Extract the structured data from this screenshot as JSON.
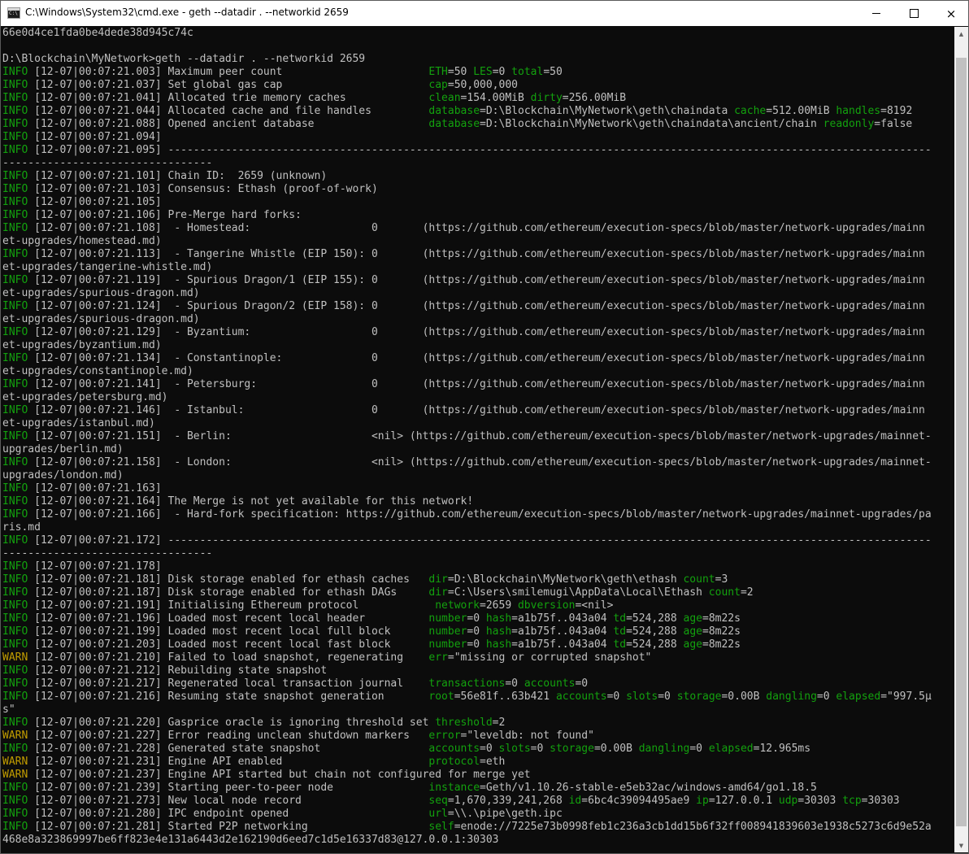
{
  "window": {
    "title": "C:\\Windows\\System32\\cmd.exe - geth  --datadir . --networkid 2659",
    "icon": "cmd-icon",
    "buttons": {
      "minimize": "minimize-icon",
      "maximize": "maximize-icon",
      "close": "×"
    }
  },
  "colors": {
    "info": "#13a10e",
    "warn": "#c19c00",
    "text": "#c0c0c0",
    "background": "#0c0c0c"
  },
  "console": {
    "lines": [
      [
        {
          "t": "66e0d4ce1fda0be4dede38d945c74c"
        }
      ],
      [
        {
          "t": ""
        }
      ],
      [
        {
          "t": "D:\\Blockchain\\MyNetwork>geth --datadir . --networkid 2659"
        }
      ],
      [
        {
          "t": "INFO",
          "c": "info"
        },
        {
          "t": " [12-07|00:07:21.003] Maximum peer count                       "
        },
        {
          "t": "ETH",
          "c": "k"
        },
        {
          "t": "=50 "
        },
        {
          "t": "LES",
          "c": "k"
        },
        {
          "t": "=0 "
        },
        {
          "t": "total",
          "c": "k"
        },
        {
          "t": "=50"
        }
      ],
      [
        {
          "t": "INFO",
          "c": "info"
        },
        {
          "t": " [12-07|00:07:21.037] Set global gas cap                       "
        },
        {
          "t": "cap",
          "c": "k"
        },
        {
          "t": "=50,000,000"
        }
      ],
      [
        {
          "t": "INFO",
          "c": "info"
        },
        {
          "t": " [12-07|00:07:21.041] Allocated trie memory caches             "
        },
        {
          "t": "clean",
          "c": "k"
        },
        {
          "t": "=154.00MiB "
        },
        {
          "t": "dirty",
          "c": "k"
        },
        {
          "t": "=256.00MiB"
        }
      ],
      [
        {
          "t": "INFO",
          "c": "info"
        },
        {
          "t": " [12-07|00:07:21.044] Allocated cache and file handles         "
        },
        {
          "t": "database",
          "c": "k"
        },
        {
          "t": "=D:\\Blockchain\\MyNetwork\\geth\\chaindata "
        },
        {
          "t": "cache",
          "c": "k"
        },
        {
          "t": "=512.00MiB "
        },
        {
          "t": "handles",
          "c": "k"
        },
        {
          "t": "=8192"
        }
      ],
      [
        {
          "t": "INFO",
          "c": "info"
        },
        {
          "t": " [12-07|00:07:21.088] Opened ancient database                  "
        },
        {
          "t": "database",
          "c": "k"
        },
        {
          "t": "=D:\\Blockchain\\MyNetwork\\geth\\chaindata\\ancient/chain "
        },
        {
          "t": "readonly",
          "c": "k"
        },
        {
          "t": "=false"
        }
      ],
      [
        {
          "t": "INFO",
          "c": "info"
        },
        {
          "t": " [12-07|00:07:21.094]"
        }
      ],
      [
        {
          "t": "INFO",
          "c": "info"
        },
        {
          "t": " [12-07|00:07:21.095] ------------------------------------------------------------------------------------------------------------------------"
        }
      ],
      [
        {
          "t": "---------------------------------"
        }
      ],
      [
        {
          "t": "INFO",
          "c": "info"
        },
        {
          "t": " [12-07|00:07:21.101] Chain ID:  2659 (unknown)"
        }
      ],
      [
        {
          "t": "INFO",
          "c": "info"
        },
        {
          "t": " [12-07|00:07:21.103] Consensus: Ethash (proof-of-work)"
        }
      ],
      [
        {
          "t": "INFO",
          "c": "info"
        },
        {
          "t": " [12-07|00:07:21.105]"
        }
      ],
      [
        {
          "t": "INFO",
          "c": "info"
        },
        {
          "t": " [12-07|00:07:21.106] Pre-Merge hard forks:"
        }
      ],
      [
        {
          "t": "INFO",
          "c": "info"
        },
        {
          "t": " [12-07|00:07:21.108]  - Homestead:                   0       (https://github.com/ethereum/execution-specs/blob/master/network-upgrades/mainn"
        }
      ],
      [
        {
          "t": "et-upgrades/homestead.md)"
        }
      ],
      [
        {
          "t": "INFO",
          "c": "info"
        },
        {
          "t": " [12-07|00:07:21.113]  - Tangerine Whistle (EIP 150): 0       (https://github.com/ethereum/execution-specs/blob/master/network-upgrades/mainn"
        }
      ],
      [
        {
          "t": "et-upgrades/tangerine-whistle.md)"
        }
      ],
      [
        {
          "t": "INFO",
          "c": "info"
        },
        {
          "t": " [12-07|00:07:21.119]  - Spurious Dragon/1 (EIP 155): 0       (https://github.com/ethereum/execution-specs/blob/master/network-upgrades/mainn"
        }
      ],
      [
        {
          "t": "et-upgrades/spurious-dragon.md)"
        }
      ],
      [
        {
          "t": "INFO",
          "c": "info"
        },
        {
          "t": " [12-07|00:07:21.124]  - Spurious Dragon/2 (EIP 158): 0       (https://github.com/ethereum/execution-specs/blob/master/network-upgrades/mainn"
        }
      ],
      [
        {
          "t": "et-upgrades/spurious-dragon.md)"
        }
      ],
      [
        {
          "t": "INFO",
          "c": "info"
        },
        {
          "t": " [12-07|00:07:21.129]  - Byzantium:                   0       (https://github.com/ethereum/execution-specs/blob/master/network-upgrades/mainn"
        }
      ],
      [
        {
          "t": "et-upgrades/byzantium.md)"
        }
      ],
      [
        {
          "t": "INFO",
          "c": "info"
        },
        {
          "t": " [12-07|00:07:21.134]  - Constantinople:              0       (https://github.com/ethereum/execution-specs/blob/master/network-upgrades/mainn"
        }
      ],
      [
        {
          "t": "et-upgrades/constantinople.md)"
        }
      ],
      [
        {
          "t": "INFO",
          "c": "info"
        },
        {
          "t": " [12-07|00:07:21.141]  - Petersburg:                  0       (https://github.com/ethereum/execution-specs/blob/master/network-upgrades/mainn"
        }
      ],
      [
        {
          "t": "et-upgrades/petersburg.md)"
        }
      ],
      [
        {
          "t": "INFO",
          "c": "info"
        },
        {
          "t": " [12-07|00:07:21.146]  - Istanbul:                    0       (https://github.com/ethereum/execution-specs/blob/master/network-upgrades/mainn"
        }
      ],
      [
        {
          "t": "et-upgrades/istanbul.md)"
        }
      ],
      [
        {
          "t": "INFO",
          "c": "info"
        },
        {
          "t": " [12-07|00:07:21.151]  - Berlin:                      <nil> (https://github.com/ethereum/execution-specs/blob/master/network-upgrades/mainnet-"
        }
      ],
      [
        {
          "t": "upgrades/berlin.md)"
        }
      ],
      [
        {
          "t": "INFO",
          "c": "info"
        },
        {
          "t": " [12-07|00:07:21.158]  - London:                      <nil> (https://github.com/ethereum/execution-specs/blob/master/network-upgrades/mainnet-"
        }
      ],
      [
        {
          "t": "upgrades/london.md)"
        }
      ],
      [
        {
          "t": "INFO",
          "c": "info"
        },
        {
          "t": " [12-07|00:07:21.163]"
        }
      ],
      [
        {
          "t": "INFO",
          "c": "info"
        },
        {
          "t": " [12-07|00:07:21.164] The Merge is not yet available for this network!"
        }
      ],
      [
        {
          "t": "INFO",
          "c": "info"
        },
        {
          "t": " [12-07|00:07:21.166]  - Hard-fork specification: https://github.com/ethereum/execution-specs/blob/master/network-upgrades/mainnet-upgrades/pa"
        }
      ],
      [
        {
          "t": "ris.md"
        }
      ],
      [
        {
          "t": "INFO",
          "c": "info"
        },
        {
          "t": " [12-07|00:07:21.172] ------------------------------------------------------------------------------------------------------------------------"
        }
      ],
      [
        {
          "t": "---------------------------------"
        }
      ],
      [
        {
          "t": "INFO",
          "c": "info"
        },
        {
          "t": " [12-07|00:07:21.178]"
        }
      ],
      [
        {
          "t": "INFO",
          "c": "info"
        },
        {
          "t": " [12-07|00:07:21.181] Disk storage enabled for ethash caches   "
        },
        {
          "t": "dir",
          "c": "k"
        },
        {
          "t": "=D:\\Blockchain\\MyNetwork\\geth\\ethash "
        },
        {
          "t": "count",
          "c": "k"
        },
        {
          "t": "=3"
        }
      ],
      [
        {
          "t": "INFO",
          "c": "info"
        },
        {
          "t": " [12-07|00:07:21.187] Disk storage enabled for ethash DAGs     "
        },
        {
          "t": "dir",
          "c": "k"
        },
        {
          "t": "=C:\\Users\\smilemugi\\AppData\\Local\\Ethash "
        },
        {
          "t": "count",
          "c": "k"
        },
        {
          "t": "=2"
        }
      ],
      [
        {
          "t": "INFO",
          "c": "info"
        },
        {
          "t": " [12-07|00:07:21.191] Initialising Ethereum protocol            "
        },
        {
          "t": "network",
          "c": "k"
        },
        {
          "t": "=2659 "
        },
        {
          "t": "dbversion",
          "c": "k"
        },
        {
          "t": "=<nil>"
        }
      ],
      [
        {
          "t": "INFO",
          "c": "info"
        },
        {
          "t": " [12-07|00:07:21.196] Loaded most recent local header          "
        },
        {
          "t": "number",
          "c": "k"
        },
        {
          "t": "=0 "
        },
        {
          "t": "hash",
          "c": "k"
        },
        {
          "t": "=a1b75f..043a04 "
        },
        {
          "t": "td",
          "c": "k"
        },
        {
          "t": "=524,288 "
        },
        {
          "t": "age",
          "c": "k"
        },
        {
          "t": "=8m22s"
        }
      ],
      [
        {
          "t": "INFO",
          "c": "info"
        },
        {
          "t": " [12-07|00:07:21.199] Loaded most recent local full block      "
        },
        {
          "t": "number",
          "c": "k"
        },
        {
          "t": "=0 "
        },
        {
          "t": "hash",
          "c": "k"
        },
        {
          "t": "=a1b75f..043a04 "
        },
        {
          "t": "td",
          "c": "k"
        },
        {
          "t": "=524,288 "
        },
        {
          "t": "age",
          "c": "k"
        },
        {
          "t": "=8m22s"
        }
      ],
      [
        {
          "t": "INFO",
          "c": "info"
        },
        {
          "t": " [12-07|00:07:21.203] Loaded most recent local fast block      "
        },
        {
          "t": "number",
          "c": "k"
        },
        {
          "t": "=0 "
        },
        {
          "t": "hash",
          "c": "k"
        },
        {
          "t": "=a1b75f..043a04 "
        },
        {
          "t": "td",
          "c": "k"
        },
        {
          "t": "=524,288 "
        },
        {
          "t": "age",
          "c": "k"
        },
        {
          "t": "=8m22s"
        }
      ],
      [
        {
          "t": "WARN",
          "c": "warn"
        },
        {
          "t": " [12-07|00:07:21.210] Failed to load snapshot, regenerating    "
        },
        {
          "t": "err",
          "c": "k"
        },
        {
          "t": "=\"missing or corrupted snapshot\""
        }
      ],
      [
        {
          "t": "INFO",
          "c": "info"
        },
        {
          "t": " [12-07|00:07:21.212] Rebuilding state snapshot"
        }
      ],
      [
        {
          "t": "INFO",
          "c": "info"
        },
        {
          "t": " [12-07|00:07:21.217] Regenerated local transaction journal    "
        },
        {
          "t": "transactions",
          "c": "k"
        },
        {
          "t": "=0 "
        },
        {
          "t": "accounts",
          "c": "k"
        },
        {
          "t": "=0"
        }
      ],
      [
        {
          "t": "INFO",
          "c": "info"
        },
        {
          "t": " [12-07|00:07:21.216] Resuming state snapshot generation       "
        },
        {
          "t": "root",
          "c": "k"
        },
        {
          "t": "=56e81f..63b421 "
        },
        {
          "t": "accounts",
          "c": "k"
        },
        {
          "t": "=0 "
        },
        {
          "t": "slots",
          "c": "k"
        },
        {
          "t": "=0 "
        },
        {
          "t": "storage",
          "c": "k"
        },
        {
          "t": "=0.00B "
        },
        {
          "t": "dangling",
          "c": "k"
        },
        {
          "t": "=0 "
        },
        {
          "t": "elapsed",
          "c": "k"
        },
        {
          "t": "=\"997.5μ"
        }
      ],
      [
        {
          "t": "s\""
        }
      ],
      [
        {
          "t": "INFO",
          "c": "info"
        },
        {
          "t": " [12-07|00:07:21.220] Gasprice oracle is ignoring threshold set "
        },
        {
          "t": "threshold",
          "c": "k"
        },
        {
          "t": "=2"
        }
      ],
      [
        {
          "t": "WARN",
          "c": "warn"
        },
        {
          "t": " [12-07|00:07:21.227] Error reading unclean shutdown markers   "
        },
        {
          "t": "error",
          "c": "k"
        },
        {
          "t": "=\"leveldb: not found\""
        }
      ],
      [
        {
          "t": "INFO",
          "c": "info"
        },
        {
          "t": " [12-07|00:07:21.228] Generated state snapshot                 "
        },
        {
          "t": "accounts",
          "c": "k"
        },
        {
          "t": "=0 "
        },
        {
          "t": "slots",
          "c": "k"
        },
        {
          "t": "=0 "
        },
        {
          "t": "storage",
          "c": "k"
        },
        {
          "t": "=0.00B "
        },
        {
          "t": "dangling",
          "c": "k"
        },
        {
          "t": "=0 "
        },
        {
          "t": "elapsed",
          "c": "k"
        },
        {
          "t": "=12.965ms"
        }
      ],
      [
        {
          "t": "WARN",
          "c": "warn"
        },
        {
          "t": " [12-07|00:07:21.231] Engine API enabled                       "
        },
        {
          "t": "protocol",
          "c": "k"
        },
        {
          "t": "=eth"
        }
      ],
      [
        {
          "t": "WARN",
          "c": "warn"
        },
        {
          "t": " [12-07|00:07:21.237] Engine API started but chain not configured for merge yet"
        }
      ],
      [
        {
          "t": "INFO",
          "c": "info"
        },
        {
          "t": " [12-07|00:07:21.239] Starting peer-to-peer node               "
        },
        {
          "t": "instance",
          "c": "k"
        },
        {
          "t": "=Geth/v1.10.26-stable-e5eb32ac/windows-amd64/go1.18.5"
        }
      ],
      [
        {
          "t": "INFO",
          "c": "info"
        },
        {
          "t": " [12-07|00:07:21.273] New local node record                    "
        },
        {
          "t": "seq",
          "c": "k"
        },
        {
          "t": "=1,670,339,241,268 "
        },
        {
          "t": "id",
          "c": "k"
        },
        {
          "t": "=6bc4c39094495ae9 "
        },
        {
          "t": "ip",
          "c": "k"
        },
        {
          "t": "=127.0.0.1 "
        },
        {
          "t": "udp",
          "c": "k"
        },
        {
          "t": "=30303 "
        },
        {
          "t": "tcp",
          "c": "k"
        },
        {
          "t": "=30303"
        }
      ],
      [
        {
          "t": "INFO",
          "c": "info"
        },
        {
          "t": " [12-07|00:07:21.280] IPC endpoint opened                      "
        },
        {
          "t": "url",
          "c": "k"
        },
        {
          "t": "=\\\\.\\pipe\\geth.ipc"
        }
      ],
      [
        {
          "t": "INFO",
          "c": "info"
        },
        {
          "t": " [12-07|00:07:21.281] Started P2P networking                   "
        },
        {
          "t": "self",
          "c": "k"
        },
        {
          "t": "=enode://7225e73b0998feb1c236a3cb1dd15b6f32ff008941839603e1938c5273c6d9e52a"
        }
      ],
      [
        {
          "t": "468e8a323869997be6ff823e4e131a6443d2e162190d6eed7c1d5e16337d83@127.0.0.1:30303"
        }
      ]
    ]
  }
}
